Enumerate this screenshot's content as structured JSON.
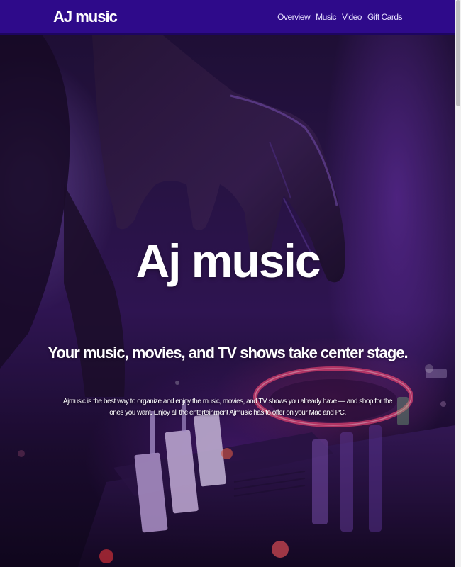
{
  "nav": {
    "brand": "AJ music",
    "links": [
      {
        "label": "Overview"
      },
      {
        "label": "Music"
      },
      {
        "label": "Video"
      },
      {
        "label": "Gift Cards"
      }
    ]
  },
  "hero": {
    "title": "Aj music",
    "subtitle": "Your music, movies, and TV shows take center stage.",
    "paragraph": "Ajmusic is the best way to organize and enjoy the music, movies, and TV shows you already have — and shop for the ones you want. Enjoy all the entertainment Ajmusic has to offer on your Mac and PC.",
    "background_image": "dj-mixer-hand-photo"
  },
  "colors": {
    "navbar": "#2e0a8a",
    "text": "#ffffff",
    "accent_purple": "#7a3fd1",
    "accent_pink": "#ff4a8a"
  }
}
